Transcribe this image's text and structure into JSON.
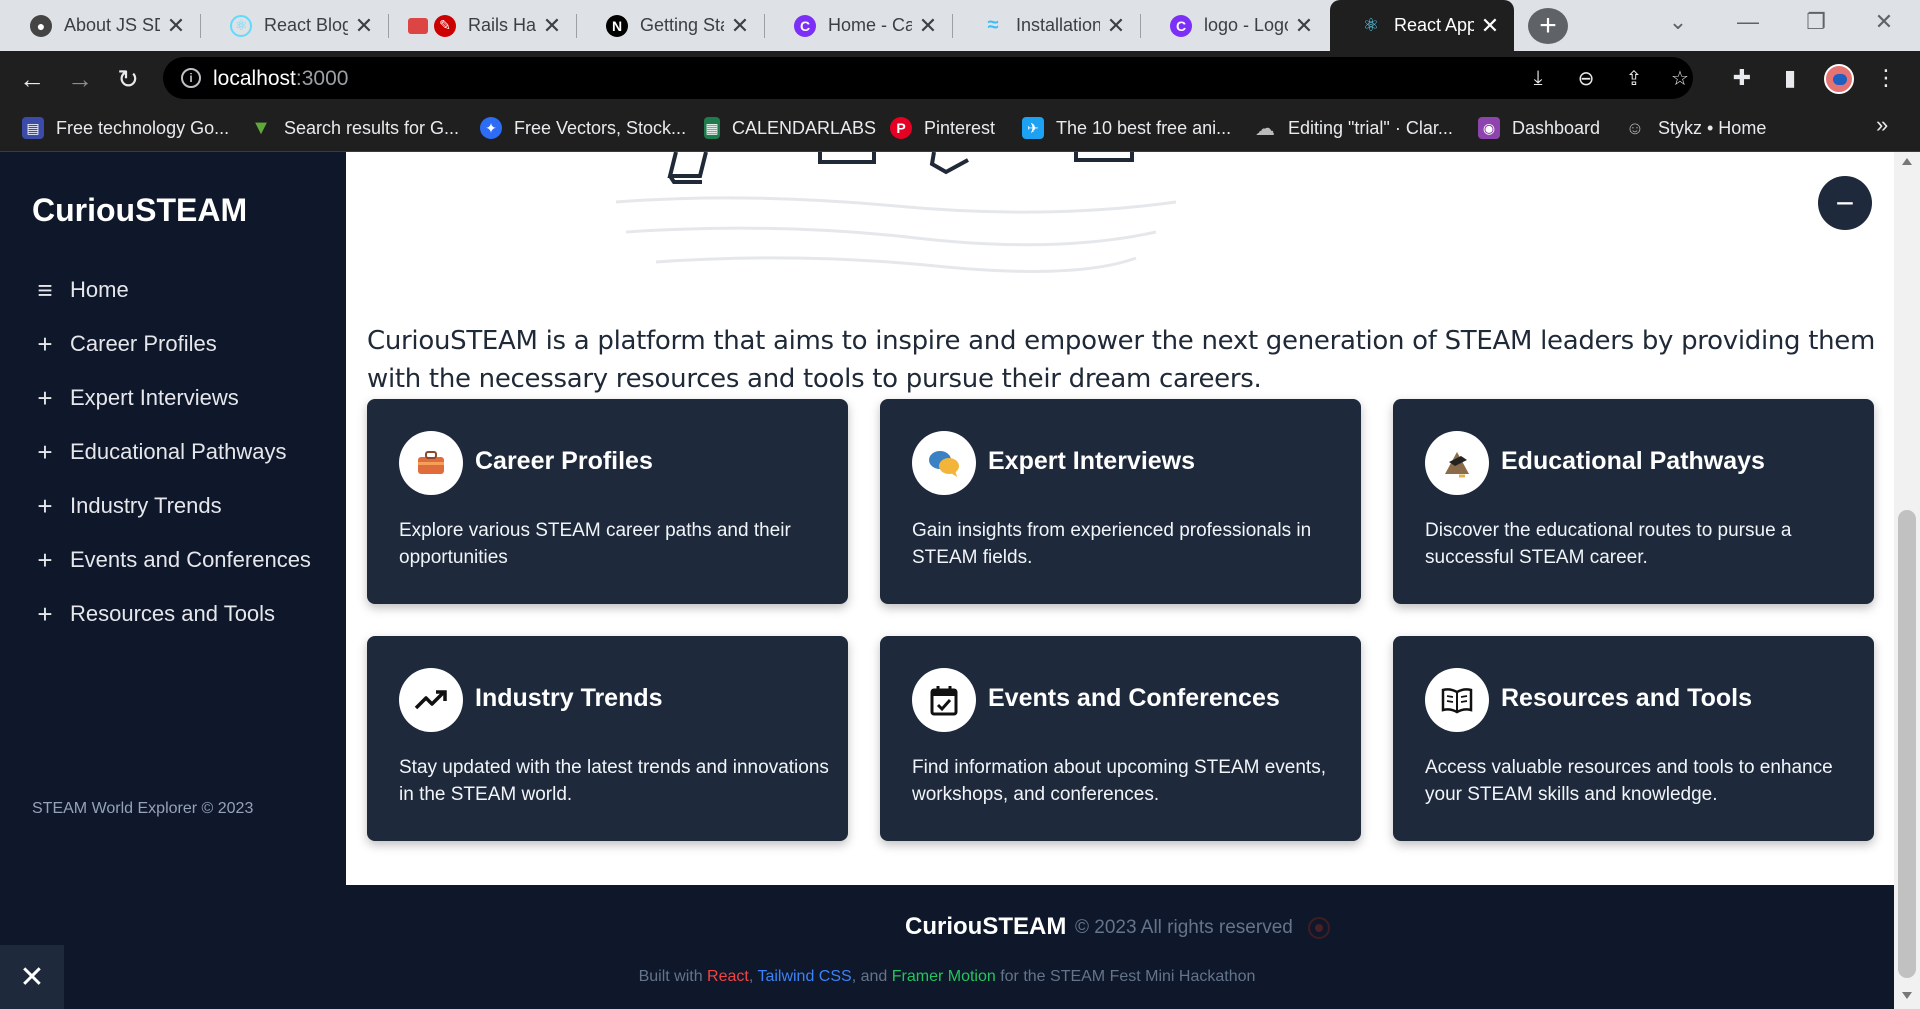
{
  "browser": {
    "tabs": [
      {
        "label": "About JS SD",
        "favicon": "github-icon",
        "color": "#444444"
      },
      {
        "label": "React Blog -",
        "favicon": "react-icon",
        "color": "#61dafb"
      },
      {
        "label": "Rails Ha",
        "favicon": "rails-icon",
        "color": "#cc0000"
      },
      {
        "label": "Getting Star",
        "favicon": "nextjs-icon",
        "color": "#000000"
      },
      {
        "label": "Home - Car",
        "favicon": "canva-icon",
        "color": "#7b2ff7"
      },
      {
        "label": "Installation",
        "favicon": "tailwind-icon",
        "color": "#38bdf8"
      },
      {
        "label": "logo - Logo",
        "favicon": "canva-icon",
        "color": "#7b2ff7"
      },
      {
        "label": "React App",
        "favicon": "react-icon",
        "color": "#61dafb"
      }
    ],
    "url_host": "localhost",
    "url_port": ":3000",
    "bookmarks": [
      {
        "label": "Free technology Go...",
        "icon": "bookmark-icon",
        "color": "#3b4ba8"
      },
      {
        "label": "Search results for G...",
        "icon": "vectorcraft-icon",
        "color": "#5fa83a"
      },
      {
        "label": "Free Vectors, Stock...",
        "icon": "freepik-icon",
        "color": "#2d6df6"
      },
      {
        "label": "CALENDARLABS",
        "icon": "calendar-icon",
        "color": "#1f7a4d"
      },
      {
        "label": "Pinterest",
        "icon": "pinterest-icon",
        "color": "#e60023"
      },
      {
        "label": "The 10 best free ani...",
        "icon": "bird-icon",
        "color": "#1da1f2"
      },
      {
        "label": "Editing \"trial\" · Clar...",
        "icon": "cloud-icon",
        "color": "#555555"
      },
      {
        "label": "Dashboard",
        "icon": "dashboard-icon",
        "color": "#8e44ad"
      },
      {
        "label": "Stykz • Home",
        "icon": "stykz-icon",
        "color": "#666666"
      }
    ]
  },
  "sidebar": {
    "brand": "CuriouSTEAM",
    "items": [
      {
        "label": "Home",
        "icon": "menu-icon"
      },
      {
        "label": "Career Profiles",
        "icon": "plus-icon"
      },
      {
        "label": "Expert Interviews",
        "icon": "plus-icon"
      },
      {
        "label": "Educational Pathways",
        "icon": "plus-icon"
      },
      {
        "label": "Industry Trends",
        "icon": "plus-icon"
      },
      {
        "label": "Events and Conferences",
        "icon": "plus-icon"
      },
      {
        "label": "Resources and Tools",
        "icon": "plus-icon"
      }
    ],
    "footer": "STEAM World Explorer © 2023"
  },
  "main": {
    "intro": "CuriouSTEAM is a platform that aims to inspire and empower the next generation of STEAM leaders by providing them with the necessary resources and tools to pursue their dream careers.",
    "cards": [
      {
        "title": "Career Profiles",
        "desc": "Explore various STEAM career paths and their opportunities",
        "icon": "briefcase-icon"
      },
      {
        "title": "Expert Interviews",
        "desc": "Gain insights from experienced professionals in STEAM fields.",
        "icon": "speech-bubbles-icon"
      },
      {
        "title": "Educational Pathways",
        "desc": "Discover the educational routes to pursue a successful STEAM career.",
        "icon": "graduation-path-icon"
      },
      {
        "title": "Industry Trends",
        "desc": "Stay updated with the latest trends and innovations in the STEAM world.",
        "icon": "trending-up-icon"
      },
      {
        "title": "Events and Conferences",
        "desc": "Find information about upcoming STEAM events, workshops, and conferences.",
        "icon": "calendar-check-icon"
      },
      {
        "title": "Resources and Tools",
        "desc": "Access valuable resources and tools to enhance your STEAM skills and knowledge.",
        "icon": "book-icon"
      }
    ]
  },
  "footer": {
    "brand": "CuriouSTEAM",
    "rights": "© 2023 All rights reserved",
    "built_prefix": "Built with ",
    "react": "React",
    "sep1": ", ",
    "tailwind": "Tailwind CSS",
    "sep2": ", and ",
    "framer": "Framer Motion",
    "built_suffix": " for the STEAM Fest Mini Hackathon"
  },
  "colors": {
    "sidebar_bg": "#0f172a",
    "card_bg": "#1e293b",
    "react_red": "#ef4444",
    "tailwind_blue": "#3b82f6",
    "framer_green": "#22c55e"
  }
}
